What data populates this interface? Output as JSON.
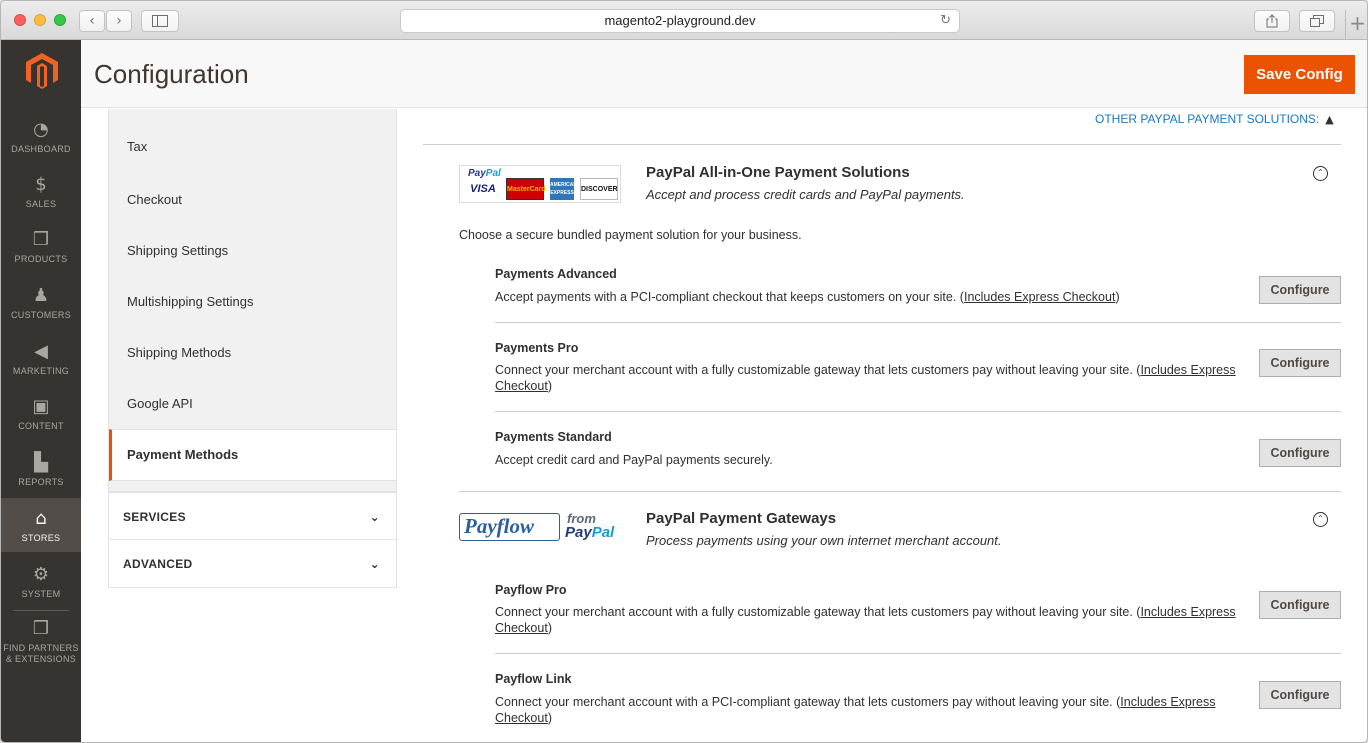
{
  "browser": {
    "url": "magento2-playground.dev",
    "back_glyph": "‹",
    "forward_glyph": "›",
    "reload_glyph": "↻",
    "newtab_glyph": "+"
  },
  "sidebar": {
    "items": [
      {
        "label": "DASHBOARD",
        "icon": "speedometer-icon",
        "glyph": "◔"
      },
      {
        "label": "SALES",
        "icon": "dollar-icon",
        "glyph": "$"
      },
      {
        "label": "PRODUCTS",
        "icon": "box-icon",
        "glyph": "❒"
      },
      {
        "label": "CUSTOMERS",
        "icon": "person-icon",
        "glyph": "♟"
      },
      {
        "label": "MARKETING",
        "icon": "megaphone-icon",
        "glyph": "◀"
      },
      {
        "label": "CONTENT",
        "icon": "layout-icon",
        "glyph": "▣"
      },
      {
        "label": "REPORTS",
        "icon": "bar-chart-icon",
        "glyph": "▙"
      },
      {
        "label": "STORES",
        "icon": "store-icon",
        "glyph": "⌂"
      },
      {
        "label": "SYSTEM",
        "icon": "gear-icon",
        "glyph": "⚙"
      }
    ],
    "partners_line1": "FIND PARTNERS",
    "partners_line2": "& EXTENSIONS",
    "partners_glyph": "❒"
  },
  "header": {
    "title": "Configuration",
    "save_label": "Save Config"
  },
  "config_nav": {
    "items": [
      "Tax",
      "Checkout",
      "Shipping Settings",
      "Multishipping Settings",
      "Shipping Methods",
      "Google API",
      "Payment Methods"
    ],
    "sections": [
      "SERVICES",
      "ADVANCED"
    ],
    "chevron": "⌄"
  },
  "main": {
    "other_solutions": "OTHER PAYPAL PAYMENT SOLUTIONS:",
    "other_arrow": "▲",
    "allinone": {
      "logo": {
        "paypal": "Pay",
        "pal": "Pal",
        "visa": "VISA",
        "mastercard": "MasterCard",
        "amex": "AMERICAN EXPRESS",
        "discover": "DISCOVER"
      },
      "title": "PayPal All-in-One Payment Solutions",
      "subtitle": "Accept and process credit cards and PayPal payments.",
      "intro": "Choose a secure bundled payment solution for your business.",
      "solutions": [
        {
          "title": "Payments Advanced",
          "desc": "Accept payments with a PCI-compliant checkout that keeps customers on your site. (",
          "link": "Includes Express Checkout",
          "tail": ")",
          "button": "Configure"
        },
        {
          "title": "Payments Pro",
          "desc": "Connect your merchant account with a fully customizable gateway that lets customers pay without leaving your site. (",
          "link": "Includes Express Checkout",
          "tail": ")",
          "button": "Configure"
        },
        {
          "title": "Payments Standard",
          "desc": "Accept credit card and PayPal payments securely.",
          "link": "",
          "tail": "",
          "button": "Configure"
        }
      ]
    },
    "gateways": {
      "logo": {
        "payflow": "Payflow",
        "from": "from",
        "pay": "Pay",
        "pal": "Pal"
      },
      "title": "PayPal Payment Gateways",
      "subtitle": "Process payments using your own internet merchant account.",
      "solutions": [
        {
          "title": "Payflow Pro",
          "desc": "Connect your merchant account with a fully customizable gateway that lets customers pay without leaving your site. (",
          "link": "Includes Express Checkout",
          "tail": ")",
          "button": "Configure"
        },
        {
          "title": "Payflow Link",
          "desc": "Connect your merchant account with a PCI-compliant gateway that lets customers pay without leaving your site. (",
          "link": "Includes Express Checkout",
          "tail": ")",
          "button": "Configure"
        }
      ]
    },
    "toggle_glyph": "⌃"
  },
  "colors": {
    "accent": "#eb5202",
    "nav_bg": "#373330",
    "link": "#1979c3"
  }
}
